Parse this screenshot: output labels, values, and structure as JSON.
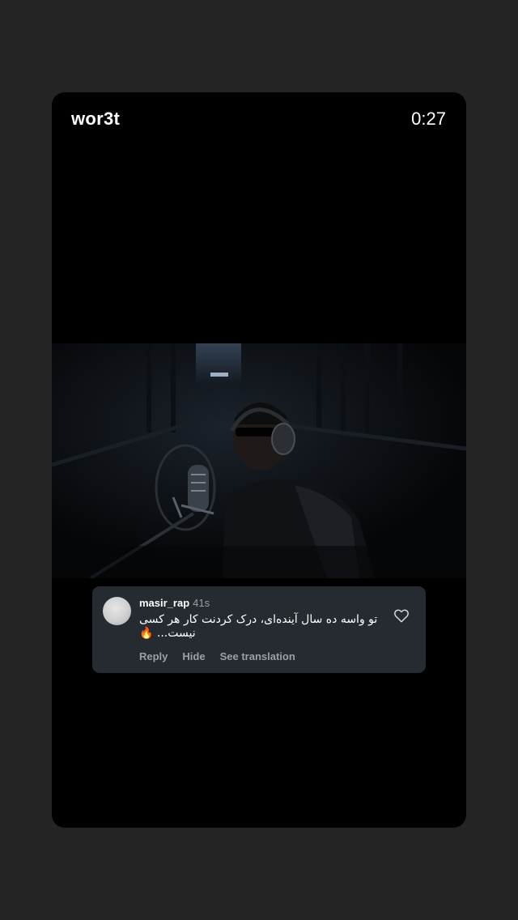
{
  "header": {
    "username": "wor3t",
    "time": "0:27"
  },
  "comment": {
    "username": "masir_rap",
    "age": "41s",
    "text": "تو واسه ده سال آینده‌ای، درک کردنت کار هر کسی نیست... 🔥",
    "actions": {
      "reply": "Reply",
      "hide": "Hide",
      "translate": "See translation"
    }
  },
  "icons": {
    "heart": "heart-outline-icon"
  }
}
